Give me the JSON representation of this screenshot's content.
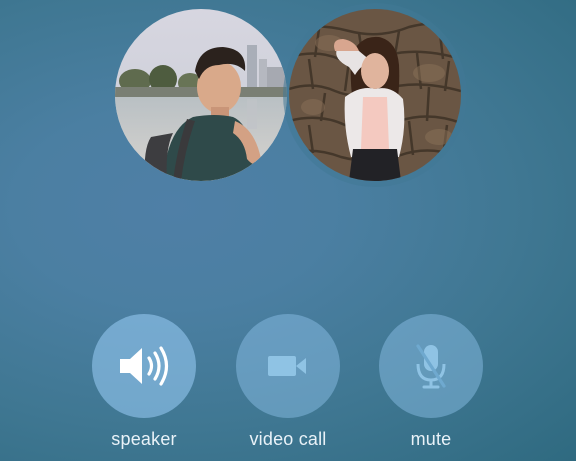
{
  "call": {
    "participants": [
      {
        "id": "participant-1"
      },
      {
        "id": "participant-2"
      }
    ]
  },
  "controls": {
    "speaker": {
      "label": "speaker",
      "icon": "speaker-icon",
      "active": true
    },
    "video_call": {
      "label": "video call",
      "icon": "video-camera-icon",
      "active": false
    },
    "mute": {
      "label": "mute",
      "icon": "microphone-muted-icon",
      "active": false
    }
  },
  "colors": {
    "background": "#467a9b",
    "button_fill": "#8bc1e8",
    "label_text": "#e9f2f8",
    "icon_active": "#ffffff",
    "icon_inactive": "#8fc3e4"
  }
}
